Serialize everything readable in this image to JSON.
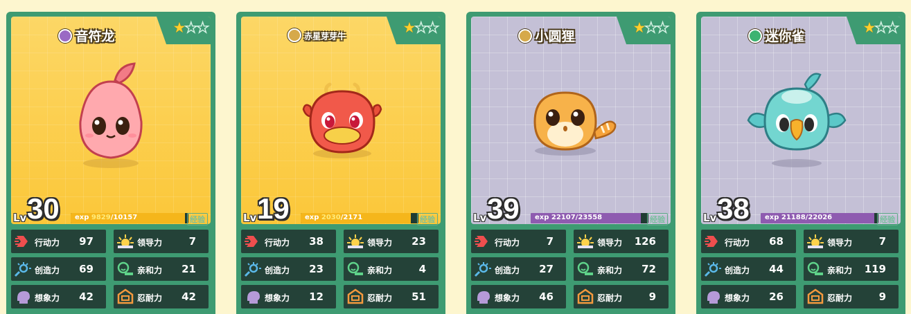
{
  "cards": [
    {
      "name": "音符龙",
      "level": "30",
      "lv_label": "Lv",
      "exp_label": "exp",
      "exp_current": "9829",
      "exp_sep_total": "/10157",
      "exp_fraction": 0.968,
      "exp_button": "经验",
      "stars_filled": 1,
      "stars_total": 3,
      "element_color": "#9a6ac4",
      "stats": {
        "action": {
          "label": "行动力",
          "value": "97"
        },
        "lead": {
          "label": "领导力",
          "value": "7"
        },
        "create": {
          "label": "创造力",
          "value": "69"
        },
        "affinity": {
          "label": "亲和力",
          "value": "21"
        },
        "imagine": {
          "label": "想象力",
          "value": "42"
        },
        "endure": {
          "label": "忍耐力",
          "value": "42"
        }
      }
    },
    {
      "name": "赤星芽芽牛",
      "level": "19",
      "lv_label": "Lv",
      "exp_label": "exp",
      "exp_current": "2030",
      "exp_sep_total": "/2171",
      "exp_fraction": 0.935,
      "exp_button": "经验",
      "stars_filled": 1,
      "stars_total": 3,
      "element_color": "#d6a94a",
      "stats": {
        "action": {
          "label": "行动力",
          "value": "38"
        },
        "lead": {
          "label": "领导力",
          "value": "23"
        },
        "create": {
          "label": "创造力",
          "value": "23"
        },
        "affinity": {
          "label": "亲和力",
          "value": "4"
        },
        "imagine": {
          "label": "想象力",
          "value": "12"
        },
        "endure": {
          "label": "忍耐力",
          "value": "51"
        }
      }
    },
    {
      "name": "小圆狸",
      "level": "39",
      "lv_label": "Lv",
      "exp_label": "exp",
      "exp_current": "22107",
      "exp_sep_total": "/23558",
      "exp_fraction": 0.938,
      "exp_button": "经验",
      "stars_filled": 1,
      "stars_total": 3,
      "element_color": "#d6a94a",
      "stats": {
        "action": {
          "label": "行动力",
          "value": "7"
        },
        "lead": {
          "label": "领导力",
          "value": "126"
        },
        "create": {
          "label": "创造力",
          "value": "27"
        },
        "affinity": {
          "label": "亲和力",
          "value": "72"
        },
        "imagine": {
          "label": "想象力",
          "value": "46"
        },
        "endure": {
          "label": "忍耐力",
          "value": "9"
        }
      }
    },
    {
      "name": "迷你雀",
      "level": "38",
      "lv_label": "Lv",
      "exp_label": "exp",
      "exp_current": "21188",
      "exp_sep_total": "/22026",
      "exp_fraction": 0.962,
      "exp_button": "经验",
      "stars_filled": 1,
      "stars_total": 3,
      "element_color": "#3cb371",
      "stats": {
        "action": {
          "label": "行动力",
          "value": "68"
        },
        "lead": {
          "label": "领导力",
          "value": "7"
        },
        "create": {
          "label": "创造力",
          "value": "44"
        },
        "affinity": {
          "label": "亲和力",
          "value": "119"
        },
        "imagine": {
          "label": "想象力",
          "value": "26"
        },
        "endure": {
          "label": "忍耐力",
          "value": "9"
        }
      }
    }
  ],
  "colors": {
    "card_green": "#3e9b72",
    "stat_bg": "#244238",
    "gold_bg": "#fbc739",
    "gray_bg": "#c4c0d6",
    "exp_gold": "#f5b61b",
    "exp_purple": "#8e5bb0"
  }
}
